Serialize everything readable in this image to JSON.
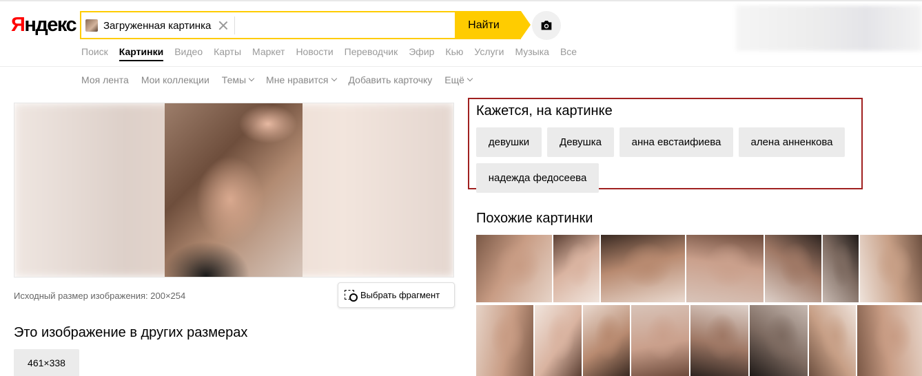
{
  "header": {
    "logo": "Яндекс",
    "search_chip_label": "Загруженная картинка",
    "search_button": "Найти"
  },
  "services": [
    "Поиск",
    "Картинки",
    "Видео",
    "Карты",
    "Маркет",
    "Новости",
    "Переводчик",
    "Эфир",
    "Кью",
    "Услуги",
    "Музыка",
    "Все"
  ],
  "active_service": "Картинки",
  "subnav": {
    "feed": "Моя лента",
    "collections": "Мои коллекции",
    "themes": "Темы",
    "likes": "Мне нравится",
    "add_card": "Добавить карточку",
    "more": "Ещё"
  },
  "image": {
    "original_size_note": "Исходный размер изображения: 200×254",
    "select_fragment": "Выбрать фрагмент",
    "other_sizes_title": "Это изображение в других размерах",
    "other_size": "461×338"
  },
  "tags": {
    "title": "Кажется, на картинке",
    "items": [
      "девушки",
      "Девушка",
      "анна евстаифиева",
      "алена анненкова",
      "надежда федосеева"
    ]
  },
  "similar": {
    "title": "Похожие картинки"
  },
  "colors": {
    "logo_red": "#ff0000",
    "search_yellow": "#ffcc00",
    "tags_border": "#a0201f"
  }
}
